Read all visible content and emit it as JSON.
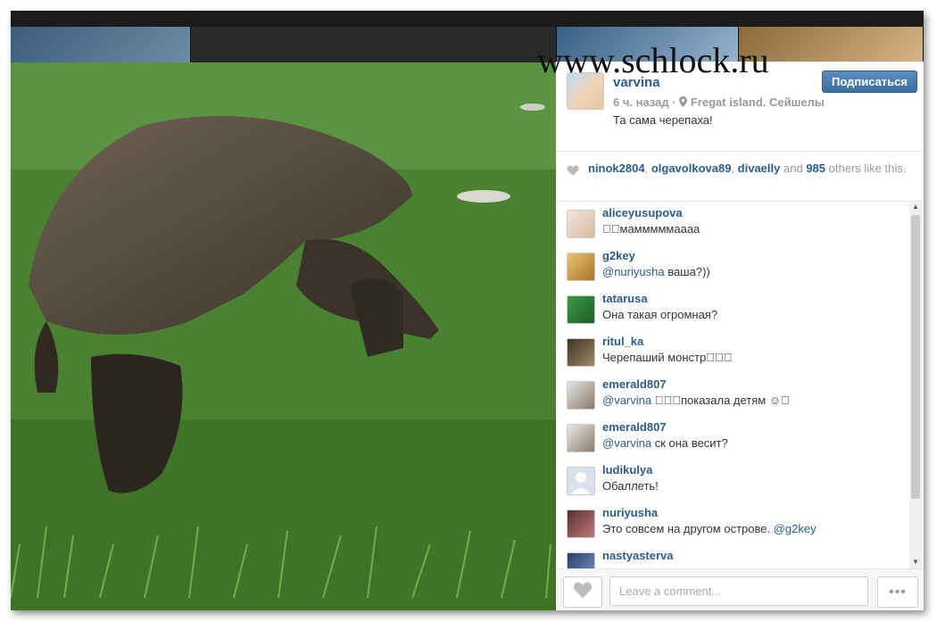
{
  "post": {
    "username": "varvina",
    "follow_label": "Подписаться",
    "time": "6 ч. назад",
    "separator": "·",
    "location_icon": "location-pin-icon",
    "location": "Fregat island. Сейшелы",
    "caption": "Та сама черепаха!"
  },
  "likes": {
    "icon": "heart-icon",
    "users": [
      "ninok2804",
      "olgavolkova89",
      "divaelly"
    ],
    "count": "985",
    "and_label": "and",
    "suffix": "others like this."
  },
  "comments": [
    {
      "user": "aliceyusupova",
      "text": "\u0000\u0000мамммммаааа"
    },
    {
      "user": "g2key",
      "mention": "@nuriyusha",
      "text": " ваша?))"
    },
    {
      "user": "tatarusa",
      "text": "Она такая огромная?"
    },
    {
      "user": "ritul_ka",
      "text": "Черепаший монстр\u0000\u0000\u0000"
    },
    {
      "user": "emerald807",
      "mention": "@varvina",
      "text": " \u0000\u0000\u0000показала детям ☺\u0000"
    },
    {
      "user": "emerald807",
      "mention": "@varvina",
      "text": " ск она весит?"
    },
    {
      "user": "ludikulya",
      "text": "Обаллеть!"
    },
    {
      "user": "nuriyusha",
      "text": "Это совсем на другом острове. ",
      "mention_after": "@g2key"
    },
    {
      "user": "nastyasterva",
      "text": ""
    }
  ],
  "footer": {
    "comment_placeholder": "Leave a comment...",
    "more_label": "•••"
  },
  "watermark": "www.schlock.ru",
  "colors": {
    "link": "#2a5d8a",
    "follow_button": "#4a7cab",
    "meta_text": "#999999"
  }
}
